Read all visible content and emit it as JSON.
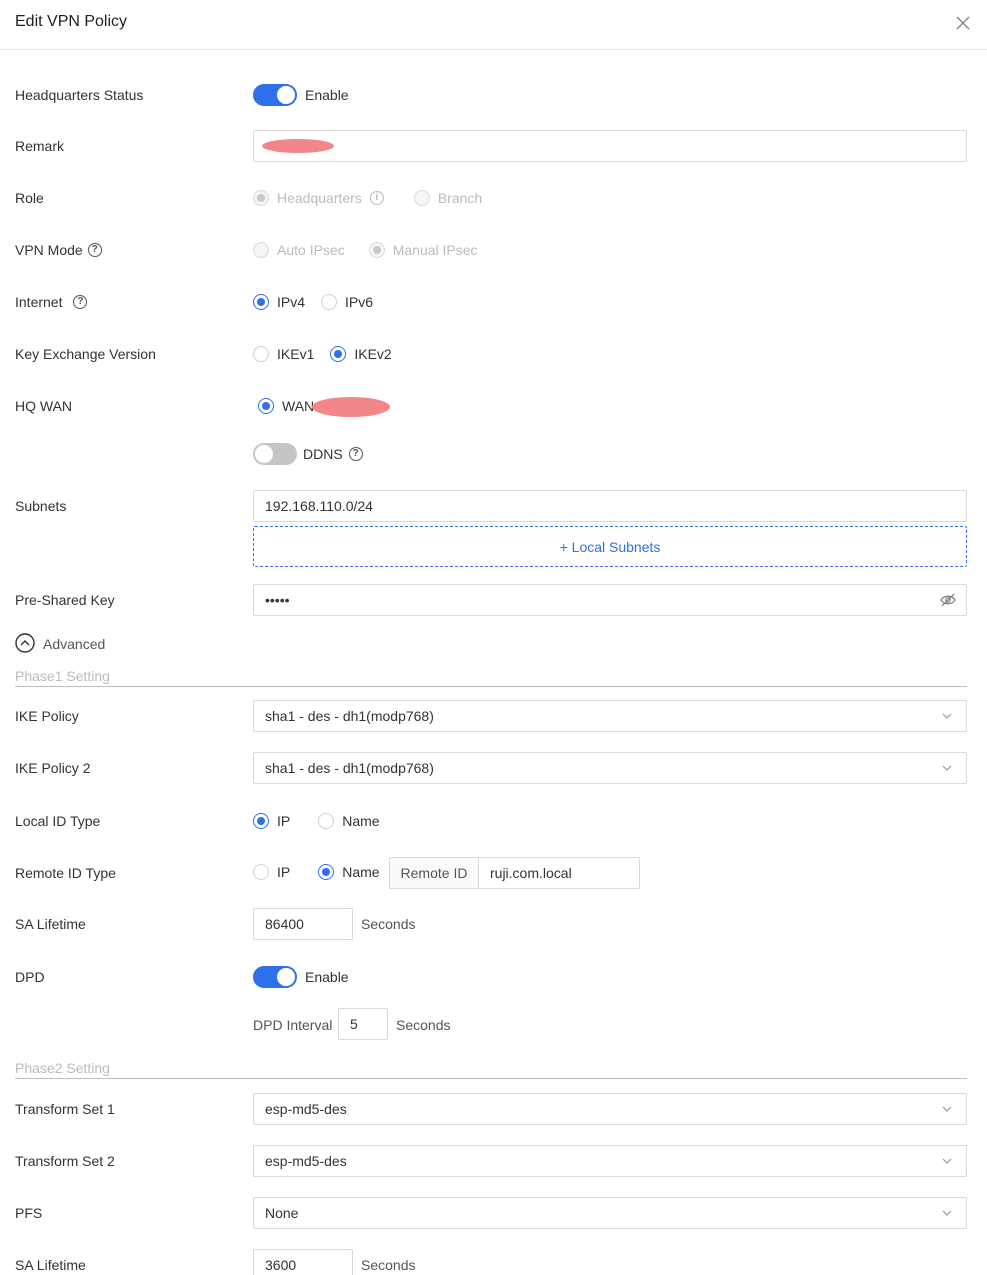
{
  "header": {
    "title": "Edit VPN Policy"
  },
  "form": {
    "hq_status": {
      "label": "Headquarters Status",
      "toggle_text": "Enable",
      "enabled": true
    },
    "remark": {
      "label": "Remark",
      "value": ""
    },
    "role": {
      "label": "Role",
      "options": [
        "Headquarters",
        "Branch"
      ],
      "selected": "Headquarters",
      "disabled": true
    },
    "vpn_mode": {
      "label": "VPN Mode",
      "options": [
        "Auto IPsec",
        "Manual IPsec"
      ],
      "selected": "Manual IPsec",
      "disabled": true
    },
    "internet": {
      "label": "Internet",
      "options": [
        "IPv4",
        "IPv6"
      ],
      "selected": "IPv4"
    },
    "key_exchange": {
      "label": "Key Exchange Version",
      "options": [
        "IKEv1",
        "IKEv2"
      ],
      "selected": "IKEv2"
    },
    "hq_wan": {
      "label": "HQ WAN",
      "option": "WAN"
    },
    "ddns": {
      "label": "DDNS",
      "enabled": false
    },
    "subnets": {
      "label": "Subnets",
      "value": "192.168.110.0/24",
      "add_button": "+ Local Subnets"
    },
    "psk": {
      "label": "Pre-Shared Key",
      "value": "•••••"
    },
    "advanced": {
      "label": "Advanced"
    },
    "phase1": {
      "title": "Phase1 Setting",
      "ike_policy": {
        "label": "IKE Policy",
        "value": "sha1 - des - dh1(modp768)"
      },
      "ike_policy2": {
        "label": "IKE Policy 2",
        "value": "sha1 - des - dh1(modp768)"
      },
      "local_id_type": {
        "label": "Local ID Type",
        "options": [
          "IP",
          "Name"
        ],
        "selected": "IP"
      },
      "remote_id_type": {
        "label": "Remote ID Type",
        "options": [
          "IP",
          "Name"
        ],
        "selected": "Name",
        "addon": "Remote ID",
        "value": "ruji.com.local"
      },
      "sa_lifetime": {
        "label": "SA Lifetime",
        "value": "86400",
        "unit": "Seconds"
      },
      "dpd": {
        "label": "DPD",
        "toggle_text": "Enable",
        "enabled": true,
        "interval_label": "DPD Interval",
        "interval_value": "5",
        "interval_unit": "Seconds"
      }
    },
    "phase2": {
      "title": "Phase2 Setting",
      "transform_set1": {
        "label": "Transform Set 1",
        "value": "esp-md5-des"
      },
      "transform_set2": {
        "label": "Transform Set 2",
        "value": "esp-md5-des"
      },
      "pfs": {
        "label": "PFS",
        "value": "None"
      },
      "sa_lifetime": {
        "label": "SA Lifetime",
        "value": "3600",
        "unit": "Seconds"
      }
    }
  },
  "colors": {
    "primary": "#2f6fea",
    "border": "#d9d9d9",
    "redaction": "#f2868a"
  }
}
